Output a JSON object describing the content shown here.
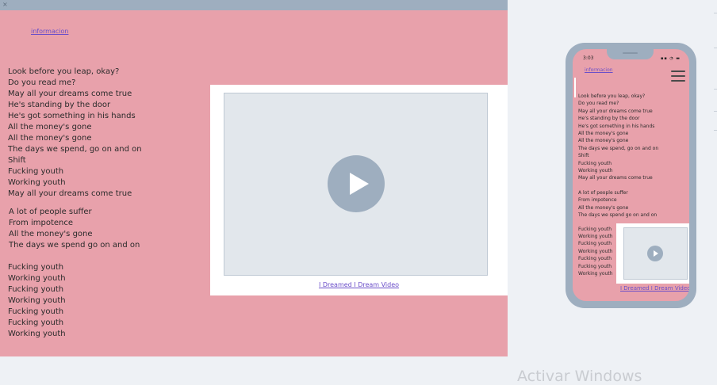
{
  "desktop": {
    "close_glyph": "×",
    "info_link": "informacion",
    "lyrics_block1": [
      "Look before you leap, okay?",
      "Do you read me?",
      "May all your dreams come true",
      "He's standing by the door",
      "He's got something in his hands",
      "All the money's gone",
      "All the money's gone",
      "The days we spend, go on and on",
      "Shift",
      "Fucking youth",
      "Working youth",
      "May all your dreams come true"
    ],
    "lyrics_block2": [
      "A lot of people suffer",
      "From impotence",
      "All the money's gone",
      "The days we spend go on and on"
    ],
    "lyrics_block3": [
      "Fucking youth",
      "Working youth",
      "Fucking youth",
      "Working youth",
      "Fucking youth",
      "Fucking youth",
      "Working youth"
    ],
    "video_title": "I Dreamed I Dream Video"
  },
  "mobile": {
    "time": "3:03",
    "status_icons": "▪▪ ◔ ▬",
    "info_link": "informacion",
    "lyrics_block1": [
      "Look before you leap, okay?",
      "Do you read me?",
      "May all your dreams come true",
      "He's standing by the door",
      "He's got something in his hands",
      "All the money's gone",
      "All the money's gone",
      "The days we spend, go on and on",
      "Shift",
      "Fucking youth",
      "Working youth",
      "May all your dreams come true"
    ],
    "lyrics_block2": [
      "A lot of people suffer",
      "From impotence",
      "All the money's gone",
      "The days we spend go on and on"
    ],
    "lyrics_block3": [
      "Fucking youth",
      "Working youth",
      "Fucking youth",
      "Working youth",
      "Fucking youth",
      "Fucking youth",
      "Working youth"
    ],
    "video_title": "I Dreamed I Dream Video"
  },
  "watermark": "Activar Windows",
  "colors": {
    "page_bg": "#eef1f5",
    "pink_bg": "#e8a1ab",
    "frame_gray": "#9eaebf",
    "link_purple": "#6b4fc9"
  },
  "icons": {
    "play": "play-icon",
    "menu": "hamburger-menu-icon"
  }
}
